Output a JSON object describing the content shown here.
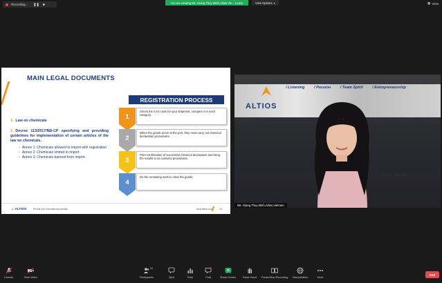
{
  "topbar": {
    "recording_label": "Recording...",
    "viewing_banner": "You are viewing Ms. Giang Thuy Minh,Altios Vie...  Leave",
    "view_options_label": "View Options",
    "view_label": "View"
  },
  "slide": {
    "title": "MAIN LEGAL DOCUMENTS",
    "documents": [
      {
        "num": "1.",
        "text": "Law on chemicals"
      },
      {
        "num": "2.",
        "text": "Decree 113/2017/NĐ-CP specifying and providing guidelines for implementation of certain articles of the law on chemicals."
      }
    ],
    "annexes": [
      "Annex 1: Chemicals allowed to import with registration",
      "Annex 2: Chemicals limited to import.",
      "Annex 3: Chemicals banned from import."
    ],
    "registration_title": "REGISTRATION PROCESS",
    "steps": [
      {
        "num": "1",
        "text": "Check the CAS code for your shipment, compare it to each category.",
        "color": "#f0941e"
      },
      {
        "num": "2",
        "text": "When the goods arrive at the port, they must carry out chemical declaration procedures.",
        "color": "#a9a9a9"
      },
      {
        "num": "3",
        "text": "Print confirmation of successful chemical declaration and bring the results to do customs procedures.",
        "color": "#f5c21b"
      },
      {
        "num": "4",
        "text": "Do the remaining work to clear the goods.",
        "color": "#5b8fd0"
      }
    ],
    "footer": {
      "logo": "ALTIOS",
      "tagline": "Reveal your international potential",
      "url": "www.altios.com",
      "page": "12"
    }
  },
  "video": {
    "logo": "ALTIOS",
    "values": [
      "/ Listening",
      "/ Passion",
      "/ Team Spirit",
      "/ Entrepreneurship"
    ],
    "city_text": "h City, Vietnam",
    "participant_name": "Ms. Giang Thuy Minh,Altios Vietnam"
  },
  "toolbar": {
    "items": [
      {
        "label": "Unmute",
        "icon": "microphone-muted-icon"
      },
      {
        "label": "Start Video",
        "icon": "video-off-icon"
      },
      {
        "label": "Participants",
        "icon": "participants-icon",
        "badge": "34"
      },
      {
        "label": "Q&A",
        "icon": "qa-icon"
      },
      {
        "label": "Polls",
        "icon": "polls-icon"
      },
      {
        "label": "Chat",
        "icon": "chat-icon"
      },
      {
        "label": "Share Screen",
        "icon": "share-screen-icon"
      },
      {
        "label": "Raise Hand",
        "icon": "raise-hand-icon"
      },
      {
        "label": "Pause/Stop Recording",
        "icon": "pause-recording-icon"
      },
      {
        "label": "Interpretation",
        "icon": "globe-icon"
      },
      {
        "label": "More",
        "icon": "more-icon"
      }
    ],
    "end_label": "End"
  },
  "colors": {
    "accent_orange": "#f0941e",
    "brand_blue": "#1e3a78",
    "banner_green": "#24a85b",
    "share_green": "#24a85b",
    "end_red": "#e5484d"
  }
}
